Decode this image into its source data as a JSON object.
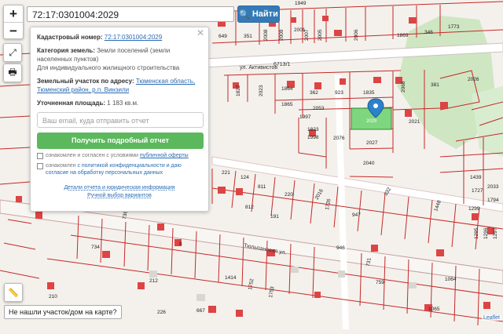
{
  "search": {
    "value": "72:17:0301004:2029",
    "button": "Найти"
  },
  "panel": {
    "cad_label": "Кадастровый номер:",
    "cad_value": "72:17:0301004:2029",
    "cat_label": "Категория земель:",
    "cat_value": "Земли поселений (земли населенных пунктов)",
    "use_value": "Для индивидуального жилищного строительства",
    "addr_label": "Земельный участок по адресу:",
    "addr_value": "Тюменская область, Тюменский район, р.п. Винзили",
    "area_label": "Уточненная площадь:",
    "area_value": "1 183 кв.м.",
    "email_placeholder": "Ваш email, куда отправить отчет",
    "get_button": "Получить подробный отчет",
    "chk1_a": "ознакомлен и согласен с условиями",
    "chk1_link": "публичной оферты",
    "chk2_a": "ознакомлен",
    "chk2_link": "с политикой конфиденциальности",
    "chk2_b": "и даю согласие на обработку персональных данных",
    "foot1": "Детали отчета и юридическая информация",
    "foot2": "Ручной выбор вариантов"
  },
  "map": {
    "street1": "ул. Активистов",
    "street2": "Тюльпановая ул.",
    "street_number": "6713/1",
    "selected_parcel": "2029",
    "parcels_top": [
      "649",
      "351",
      "2008",
      "2009",
      "2001",
      "2007",
      "2005",
      "2006",
      "1949",
      "1869",
      "346",
      "1773"
    ],
    "parcels_mid": [
      "1822",
      "2023",
      "1864",
      "1865",
      "362",
      "923",
      "1835",
      "2068",
      "2026",
      "381",
      "2021",
      "1997",
      "1823",
      "1998",
      "2076",
      "2027",
      "2040",
      "2053"
    ],
    "parcels_low": [
      "221",
      "124",
      "811",
      "220",
      "812",
      "2016",
      "191",
      "1726",
      "947",
      "332",
      "1448",
      "1439",
      "2033",
      "1727",
      "1299",
      "1794",
      "1295",
      "1296",
      "1297"
    ],
    "parcels_bottom": [
      "734",
      "8",
      "1414",
      "946",
      "731",
      "1752",
      "1753",
      "759",
      "1064",
      "212",
      "210",
      "667",
      "1065",
      "226",
      "736"
    ]
  },
  "notfound": "Не нашли участок/дом на карте?",
  "attribution": "Leaflet"
}
